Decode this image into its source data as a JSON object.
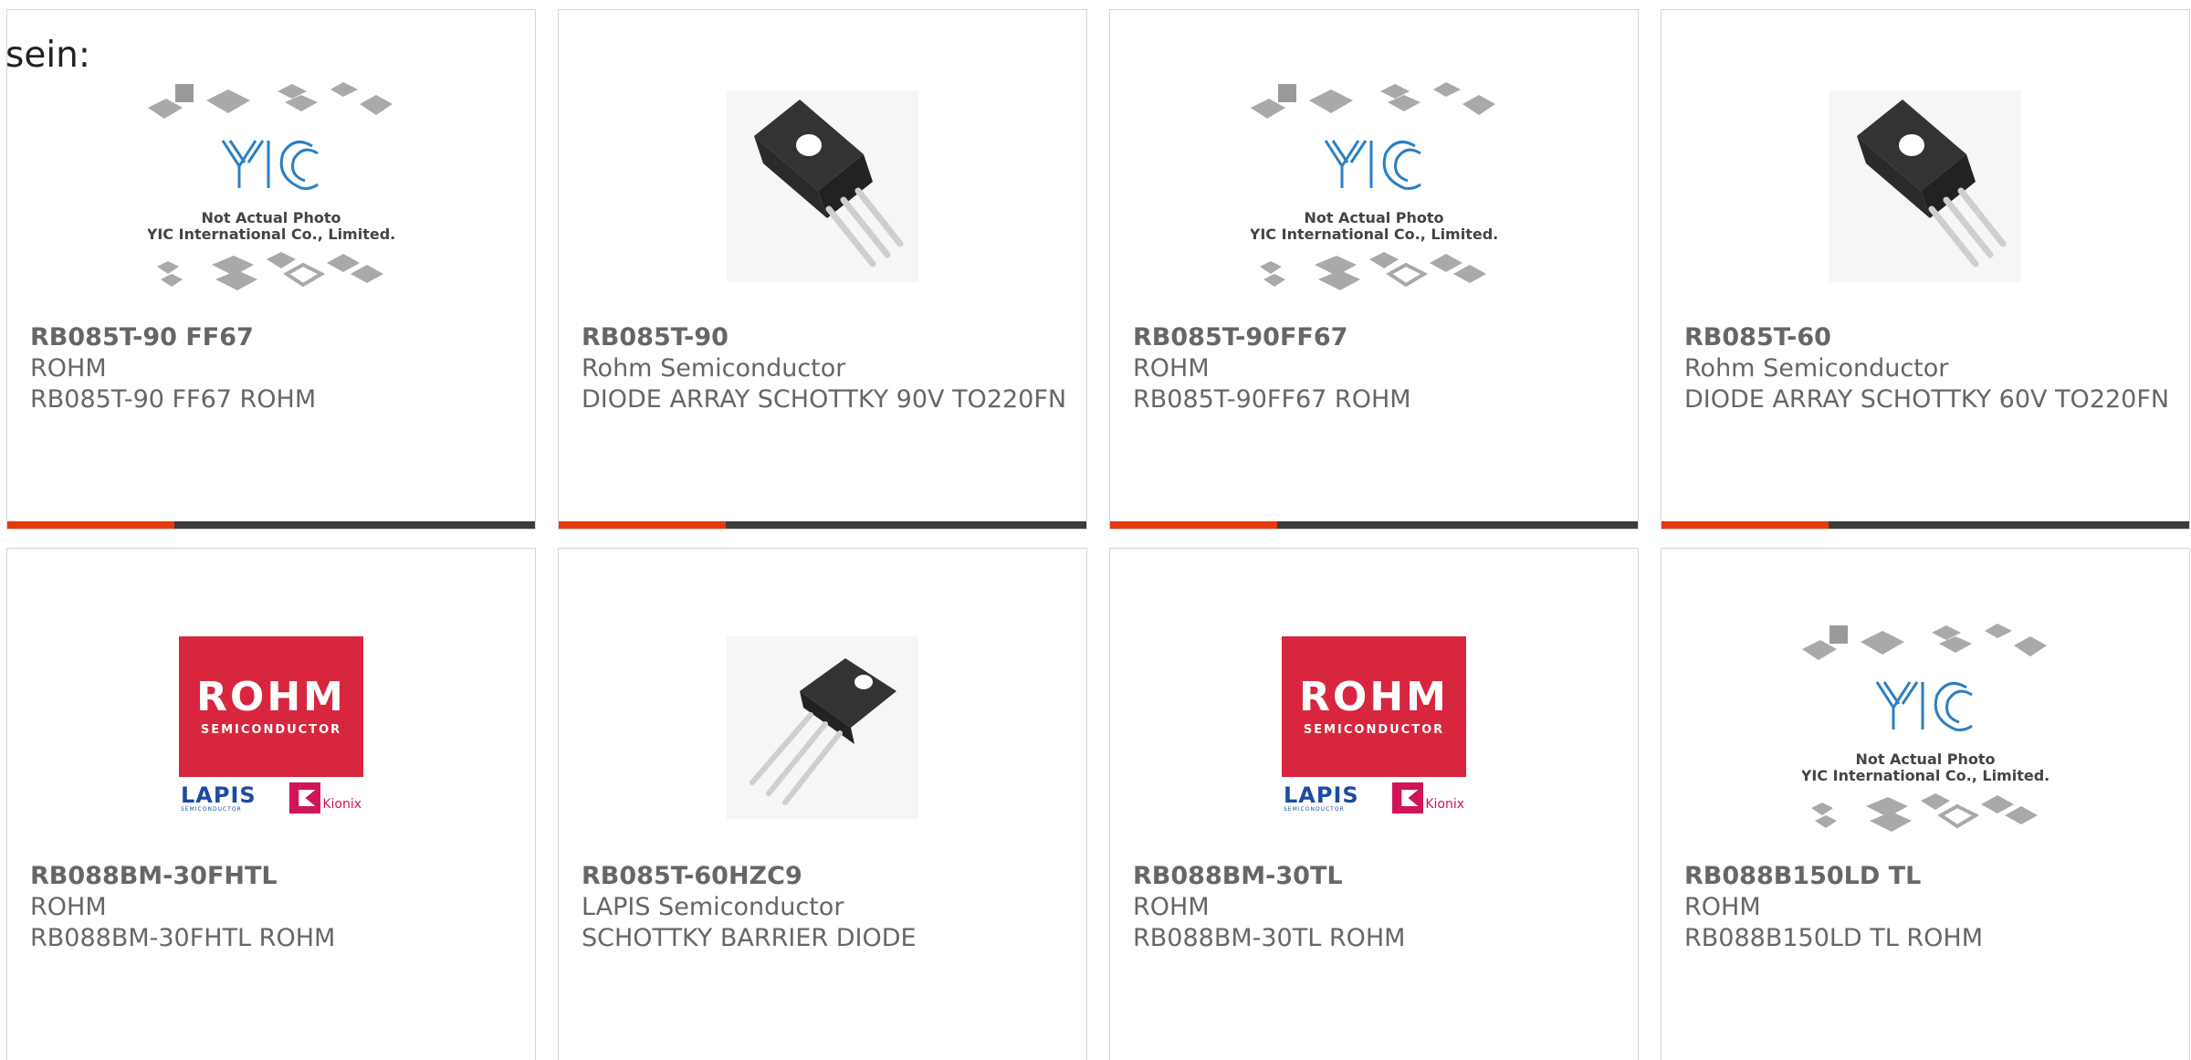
{
  "intro": "sein:",
  "placeholder_photo": {
    "line1": "Not Actual Photo",
    "line2": "YIC International Co., Limited.",
    "logo": "YIC"
  },
  "logo_rohm": {
    "brand": "ROHM",
    "subtitle": "SEMICONDUCTOR",
    "lapis": "LAPIS",
    "lapis_sub": "SEMICONDUCTOR",
    "kionix": "Kionix"
  },
  "colors": {
    "accent": "#e8380d",
    "bar_dark": "#3c3c3c",
    "rohm_red": "#d7263d",
    "yic_blue": "#2b7fc1"
  },
  "products": [
    {
      "part": "RB085T-90 FF67",
      "manufacturer": "ROHM",
      "description": "RB085T-90 FF67 ROHM",
      "image": "placeholder-photo"
    },
    {
      "part": "RB085T-90",
      "manufacturer": "Rohm Semiconductor",
      "description": "DIODE ARRAY SCHOTTKY 90V TO220FN",
      "image": "to220-package"
    },
    {
      "part": "RB085T-90FF67",
      "manufacturer": "ROHM",
      "description": "RB085T-90FF67 ROHM",
      "image": "placeholder-photo"
    },
    {
      "part": "RB085T-60",
      "manufacturer": "Rohm Semiconductor",
      "description": "DIODE ARRAY SCHOTTKY 60V TO220FN",
      "image": "to220-package"
    },
    {
      "part": "RB088BM-30FHTL",
      "manufacturer": "ROHM",
      "description": "RB088BM-30FHTL ROHM",
      "image": "rohm-logo"
    },
    {
      "part": "RB085T-60HZC9",
      "manufacturer": "LAPIS Semiconductor",
      "description": "SCHOTTKY BARRIER DIODE",
      "image": "to220-package-small"
    },
    {
      "part": "RB088BM-30TL",
      "manufacturer": "ROHM",
      "description": "RB088BM-30TL ROHM",
      "image": "rohm-logo"
    },
    {
      "part": "RB088B150LD TL",
      "manufacturer": "ROHM",
      "description": "RB088B150LD TL ROHM",
      "image": "placeholder-photo"
    }
  ]
}
